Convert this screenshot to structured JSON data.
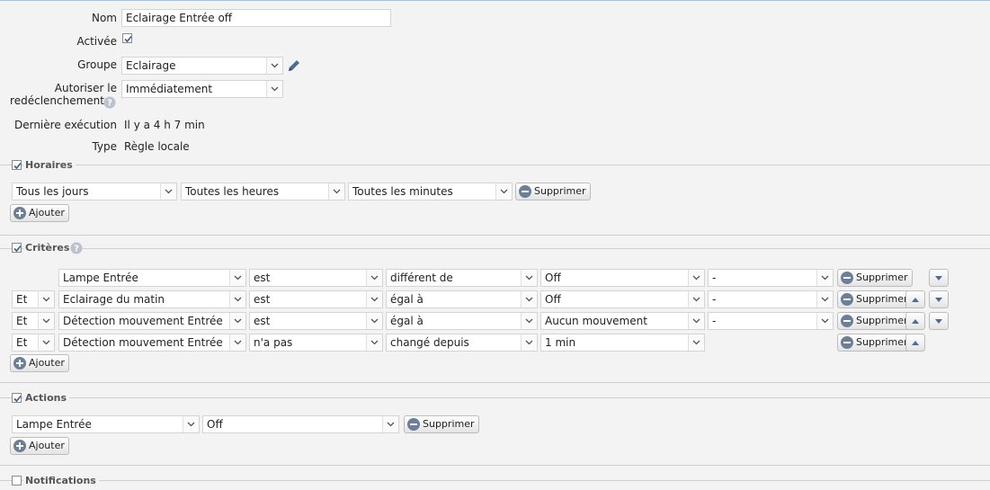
{
  "form": {
    "nom_label": "Nom",
    "nom_value": "Eclairage Entrée off",
    "activee_label": "Activée",
    "groupe_label": "Groupe",
    "groupe_value": "Eclairage",
    "autoriser_label_1": "Autoriser le",
    "autoriser_label_2": "redéclenchement",
    "autoriser_value": "Immédiatement",
    "derniere_label": "Dernière exécution",
    "derniere_value": "Il y a 4 h 7 min",
    "type_label": "Type",
    "type_value": "Règle locale"
  },
  "horaires": {
    "title": "Horaires",
    "jour": "Tous les jours",
    "heures": "Toutes les heures",
    "minutes": "Toutes les minutes",
    "remove_label": "Supprimer",
    "add_label": "Ajouter"
  },
  "criteres": {
    "title": "Critères",
    "remove_label": "Supprimer",
    "add_label": "Ajouter",
    "rows": [
      {
        "conj": "",
        "device": "Lampe Entrée",
        "verb": "est",
        "op": "différent de",
        "value": "Off",
        "extra": "-"
      },
      {
        "conj": "Et",
        "device": "Eclairage du matin",
        "verb": "est",
        "op": "égal à",
        "value": "Off",
        "extra": "-"
      },
      {
        "conj": "Et",
        "device": "Détection mouvement Entrée",
        "verb": "est",
        "op": "égal à",
        "value": "Aucun mouvement",
        "extra": "-"
      },
      {
        "conj": "Et",
        "device": "Détection mouvement Entrée",
        "verb": "n'a pas",
        "op": "changé depuis",
        "value": "1 min",
        "extra": ""
      }
    ]
  },
  "actions": {
    "title": "Actions",
    "device": "Lampe Entrée",
    "value": "Off",
    "remove_label": "Supprimer",
    "add_label": "Ajouter"
  },
  "notifications": {
    "title": "Notifications"
  }
}
